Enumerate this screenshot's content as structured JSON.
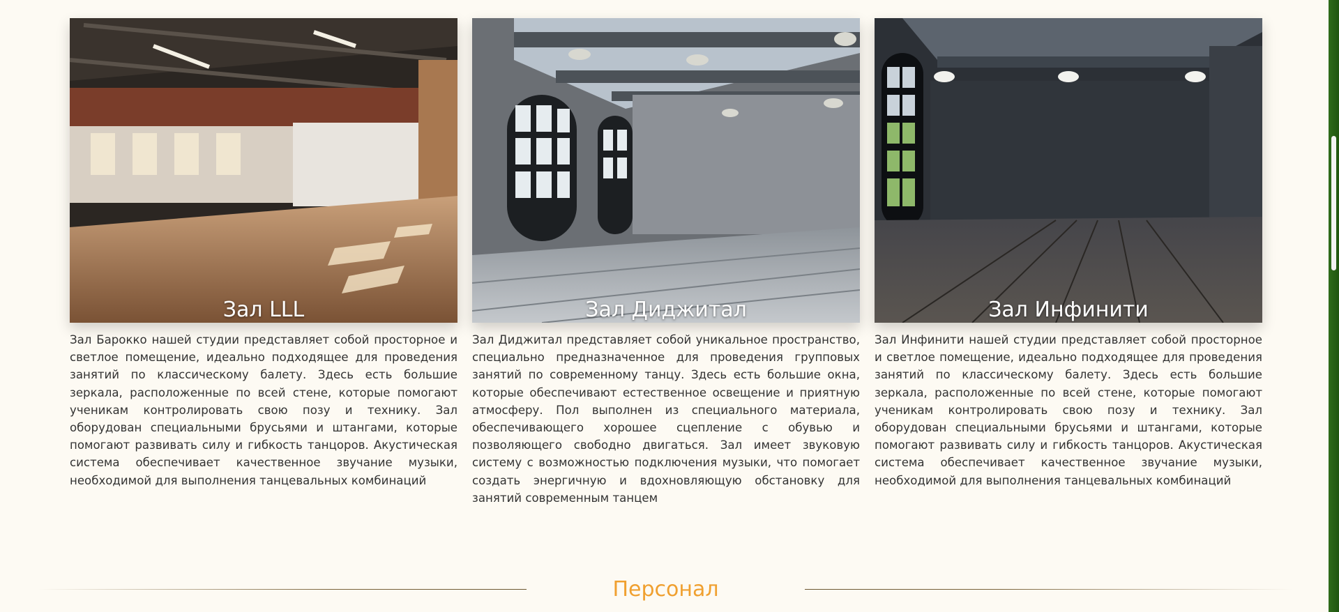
{
  "halls": [
    {
      "title": "Зал LLL",
      "description": "Зал Барокко нашей студии представляет собой просторное и светлое помещение, идеально подходящее для проведения занятий по классическому балету. Здесь есть большие зеркала, расположенные по всей стене, которые помогают ученикам контролировать свою позу и технику. Зал оборудован специальными брусьями и штангами, которые помогают развивать силу и гибкость танцоров. Акустическая система обеспечивает качественное звучание музыки, необходимой для выполнения танцевальных комбинаций"
    },
    {
      "title": "Зал Диджитал",
      "description": "Зал Диджитал представляет собой уникальное пространство, специально предназначенное для проведения групповых занятий по современному танцу. Здесь есть большие окна, которые обеспечивают естественное освещение и приятную атмосферу. Пол выполнен из специального материала, обеспечивающего хорошее сцепление с обувью и позволяющего свободно двигаться. Зал имеет звуковую систему с возможностью подключения музыки, что помогает создать энергичную и вдохновляющую обстановку для занятий современным танцем"
    },
    {
      "title": "Зал Инфинити",
      "description": "Зал Инфинити нашей студии представляет собой просторное и светлое помещение, идеально подходящее для проведения занятий по классическому балету. Здесь есть большие зеркала, расположенные по всей стене, которые помогают ученикам контролировать свою позу и технику. Зал оборудован специальными брусьями и штангами, которые помогают развивать силу и гибкость танцоров. Акустическая система обеспечивает качественное звучание музыки, необходимой для выполнения танцевальных комбинаций"
    }
  ],
  "staff_section": {
    "title": "Персонал"
  },
  "colors": {
    "background": "#fdfaf3",
    "accent": "#f0a030",
    "text": "#333333",
    "scrollbar": "#2f6b1a"
  }
}
